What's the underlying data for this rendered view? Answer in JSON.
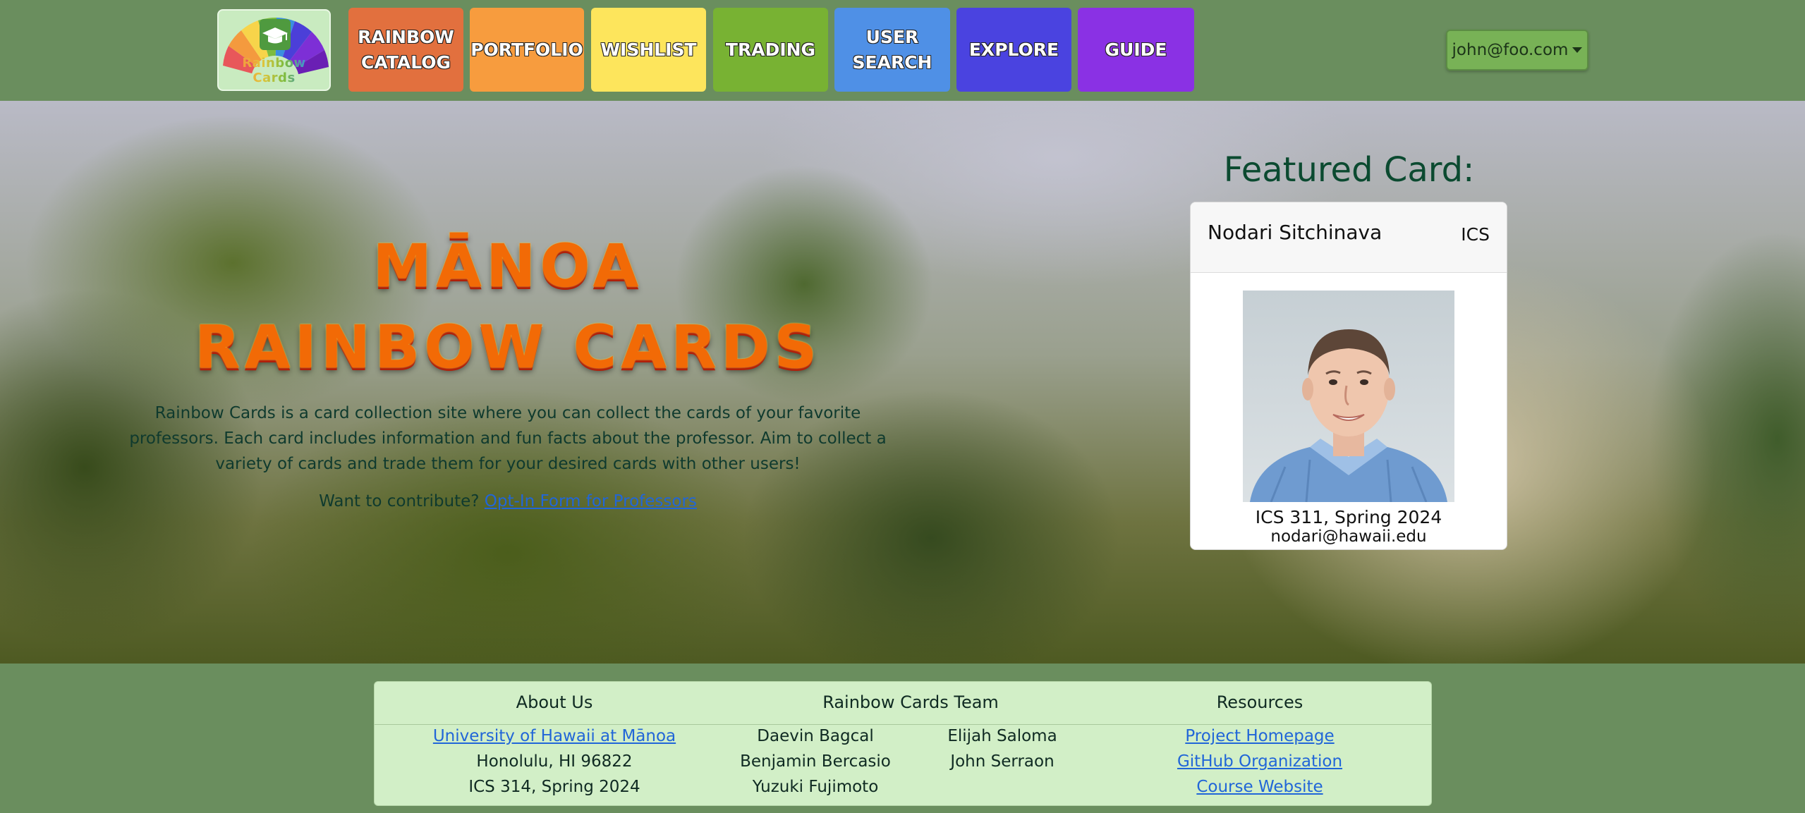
{
  "nav": {
    "logo_text": "Rainbow Cards",
    "buttons": [
      {
        "label": "RAINBOW\nCATALOG",
        "color": "#e2703e"
      },
      {
        "label": "PORTFOLIO",
        "color": "#f79c3e"
      },
      {
        "label": "WISHLIST",
        "color": "#fde55c"
      },
      {
        "label": "TRADING",
        "color": "#78b233"
      },
      {
        "label": "USER\nSEARCH",
        "color": "#4f90e6"
      },
      {
        "label": "EXPLORE",
        "color": "#4a43e0"
      },
      {
        "label": "GUIDE",
        "color": "#8a31e4"
      }
    ],
    "user_email": "john@foo.com"
  },
  "hero": {
    "title_line1": "MĀNOA",
    "title_line2": "RAINBOW CARDS",
    "description": "Rainbow Cards is a card collection site where you can collect the cards of your favorite professors. Each card includes information and fun facts about the professor. Aim to collect a variety of cards and trade them for your desired cards with other users!",
    "contribute_prompt": "Want to contribute?",
    "contribute_link": "Opt-In Form for Professors"
  },
  "featured": {
    "heading": "Featured Card:",
    "name": "Nodari Sitchinava",
    "department": "ICS",
    "course": "ICS 311, Spring 2024",
    "email": "nodari@hawaii.edu"
  },
  "footer": {
    "about": {
      "heading": "About Us",
      "link": "University of Hawaii at Mānoa",
      "address": "Honolulu, HI 96822",
      "course": "ICS 314, Spring 2024"
    },
    "team": {
      "heading": "Rainbow Cards Team",
      "members": [
        "Daevin Bagcal",
        "Benjamin Bercasio",
        "Yuzuki Fujimoto",
        "Elijah Saloma",
        "John Serraon"
      ]
    },
    "resources": {
      "heading": "Resources",
      "links": [
        "Project Homepage",
        "GitHub Organization",
        "Course Website"
      ]
    }
  },
  "colors": {
    "page_bg": "#6a8e5e",
    "footer_bg": "#d2efc7",
    "link": "#2166d8",
    "title_orange": "#f26a06"
  }
}
